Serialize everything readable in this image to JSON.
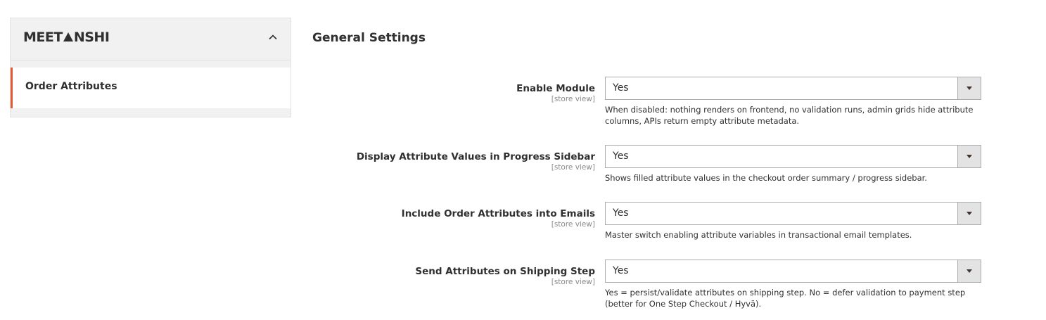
{
  "sidebar": {
    "brand": {
      "before": "MEET",
      "after": "NSHI"
    },
    "items": [
      {
        "label": "Order Attributes"
      }
    ]
  },
  "main": {
    "section_title": "General Settings",
    "fields": [
      {
        "label": "Enable Module",
        "scope": "[store view]",
        "value": "Yes",
        "note": "When disabled: nothing renders on frontend, no validation runs, admin grids hide attribute columns, APIs return empty attribute metadata."
      },
      {
        "label": "Display Attribute Values in Progress Sidebar",
        "scope": "[store view]",
        "value": "Yes",
        "note": "Shows filled attribute values in the checkout order summary / progress sidebar."
      },
      {
        "label": "Include Order Attributes into Emails",
        "scope": "[store view]",
        "value": "Yes",
        "note": "Master switch enabling attribute variables in transactional email templates."
      },
      {
        "label": "Send Attributes on Shipping Step",
        "scope": "[store view]",
        "value": "Yes",
        "note": "Yes = persist/validate attributes on shipping step. No = defer validation to payment step (better for One Step Checkout / Hyvä)."
      }
    ]
  },
  "colors": {
    "accent": "#e05a34",
    "sidebar_bg": "#f1f1f1"
  }
}
